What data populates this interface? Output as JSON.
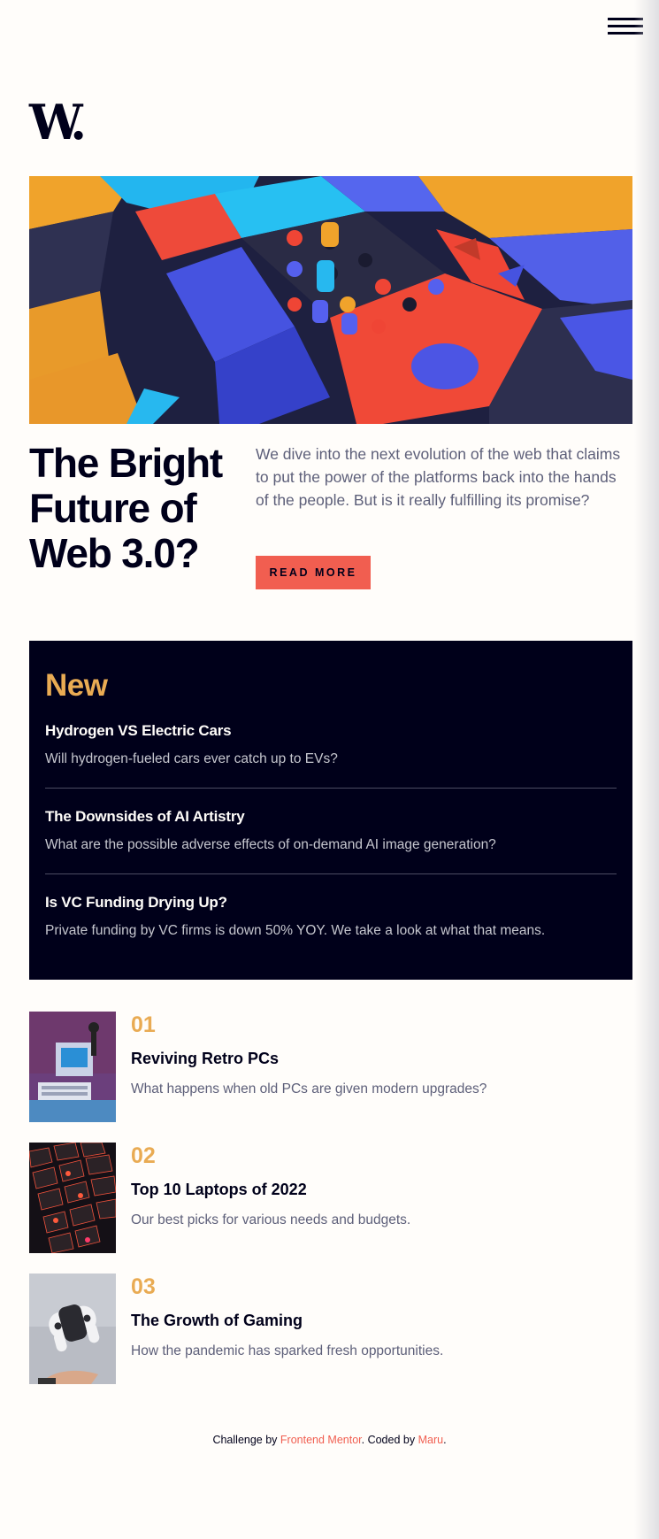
{
  "header": {
    "logo": "W.",
    "menu_icon": "hamburger-menu-icon"
  },
  "hero": {
    "image_alt": "colorful abstract 3D blocks",
    "title": "The Bright Future of Web 3.0?",
    "description": "We dive into the next evolution of the web that claims to put the power of the platforms back into the hands of the people. But is it really fulfilling its promise?",
    "button_label": "READ MORE"
  },
  "new_section": {
    "heading": "New",
    "items": [
      {
        "title": "Hydrogen VS Electric Cars",
        "description": "Will hydrogen-fueled cars ever catch up to EVs?"
      },
      {
        "title": "The Downsides of AI Artistry",
        "description": "What are the possible adverse effects of on-demand AI image generation?"
      },
      {
        "title": "Is VC Funding Drying Up?",
        "description": "Private funding by VC firms is down 50% YOY. We take a look at what that means."
      }
    ]
  },
  "cards": [
    {
      "number": "01",
      "title": "Reviving Retro PCs",
      "description": "What happens when old PCs are given modern upgrades?",
      "image_alt": "retro computers"
    },
    {
      "number": "02",
      "title": "Top 10 Laptops of 2022",
      "description": "Our best picks for various needs and budgets.",
      "image_alt": "laptop keyboard"
    },
    {
      "number": "03",
      "title": "The Growth of Gaming",
      "description": "How the pandemic has sparked fresh opportunities.",
      "image_alt": "game controller"
    }
  ],
  "footer": {
    "prefix": "Challenge by",
    "link1": "Frontend Mentor",
    "middle": ". Coded by",
    "link2": "Maru",
    "suffix": "."
  },
  "colors": {
    "background": "#fffdfa",
    "accent_red": "#f15e50",
    "accent_orange": "#e9ab53",
    "dark_navy": "#00001a",
    "grayish_blue": "#5d5f79"
  }
}
